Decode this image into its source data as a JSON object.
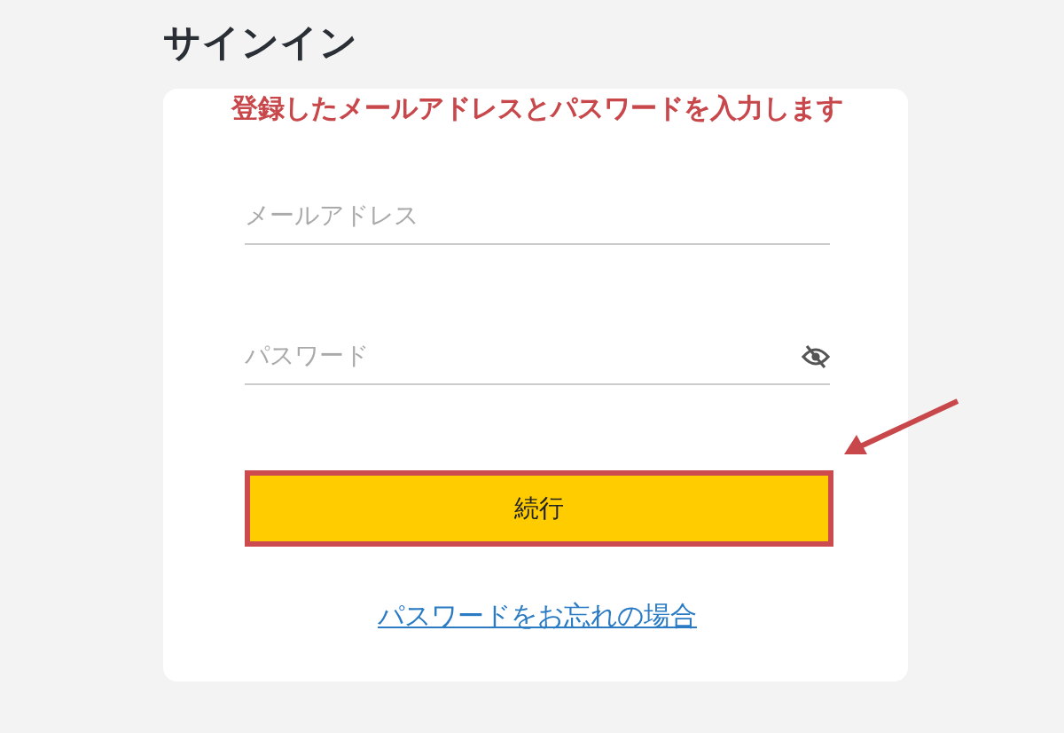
{
  "title": "サインイン",
  "annotation": {
    "text": "登録したメールアドレスとパスワードを入力します"
  },
  "fields": [
    {
      "placeholder": "メールアドレス",
      "kind": "text"
    },
    {
      "placeholder": "パスワード",
      "kind": "password"
    }
  ],
  "button": {
    "label": "続行",
    "highlighted": true
  },
  "link": "パスワードをお忘れの場合"
}
